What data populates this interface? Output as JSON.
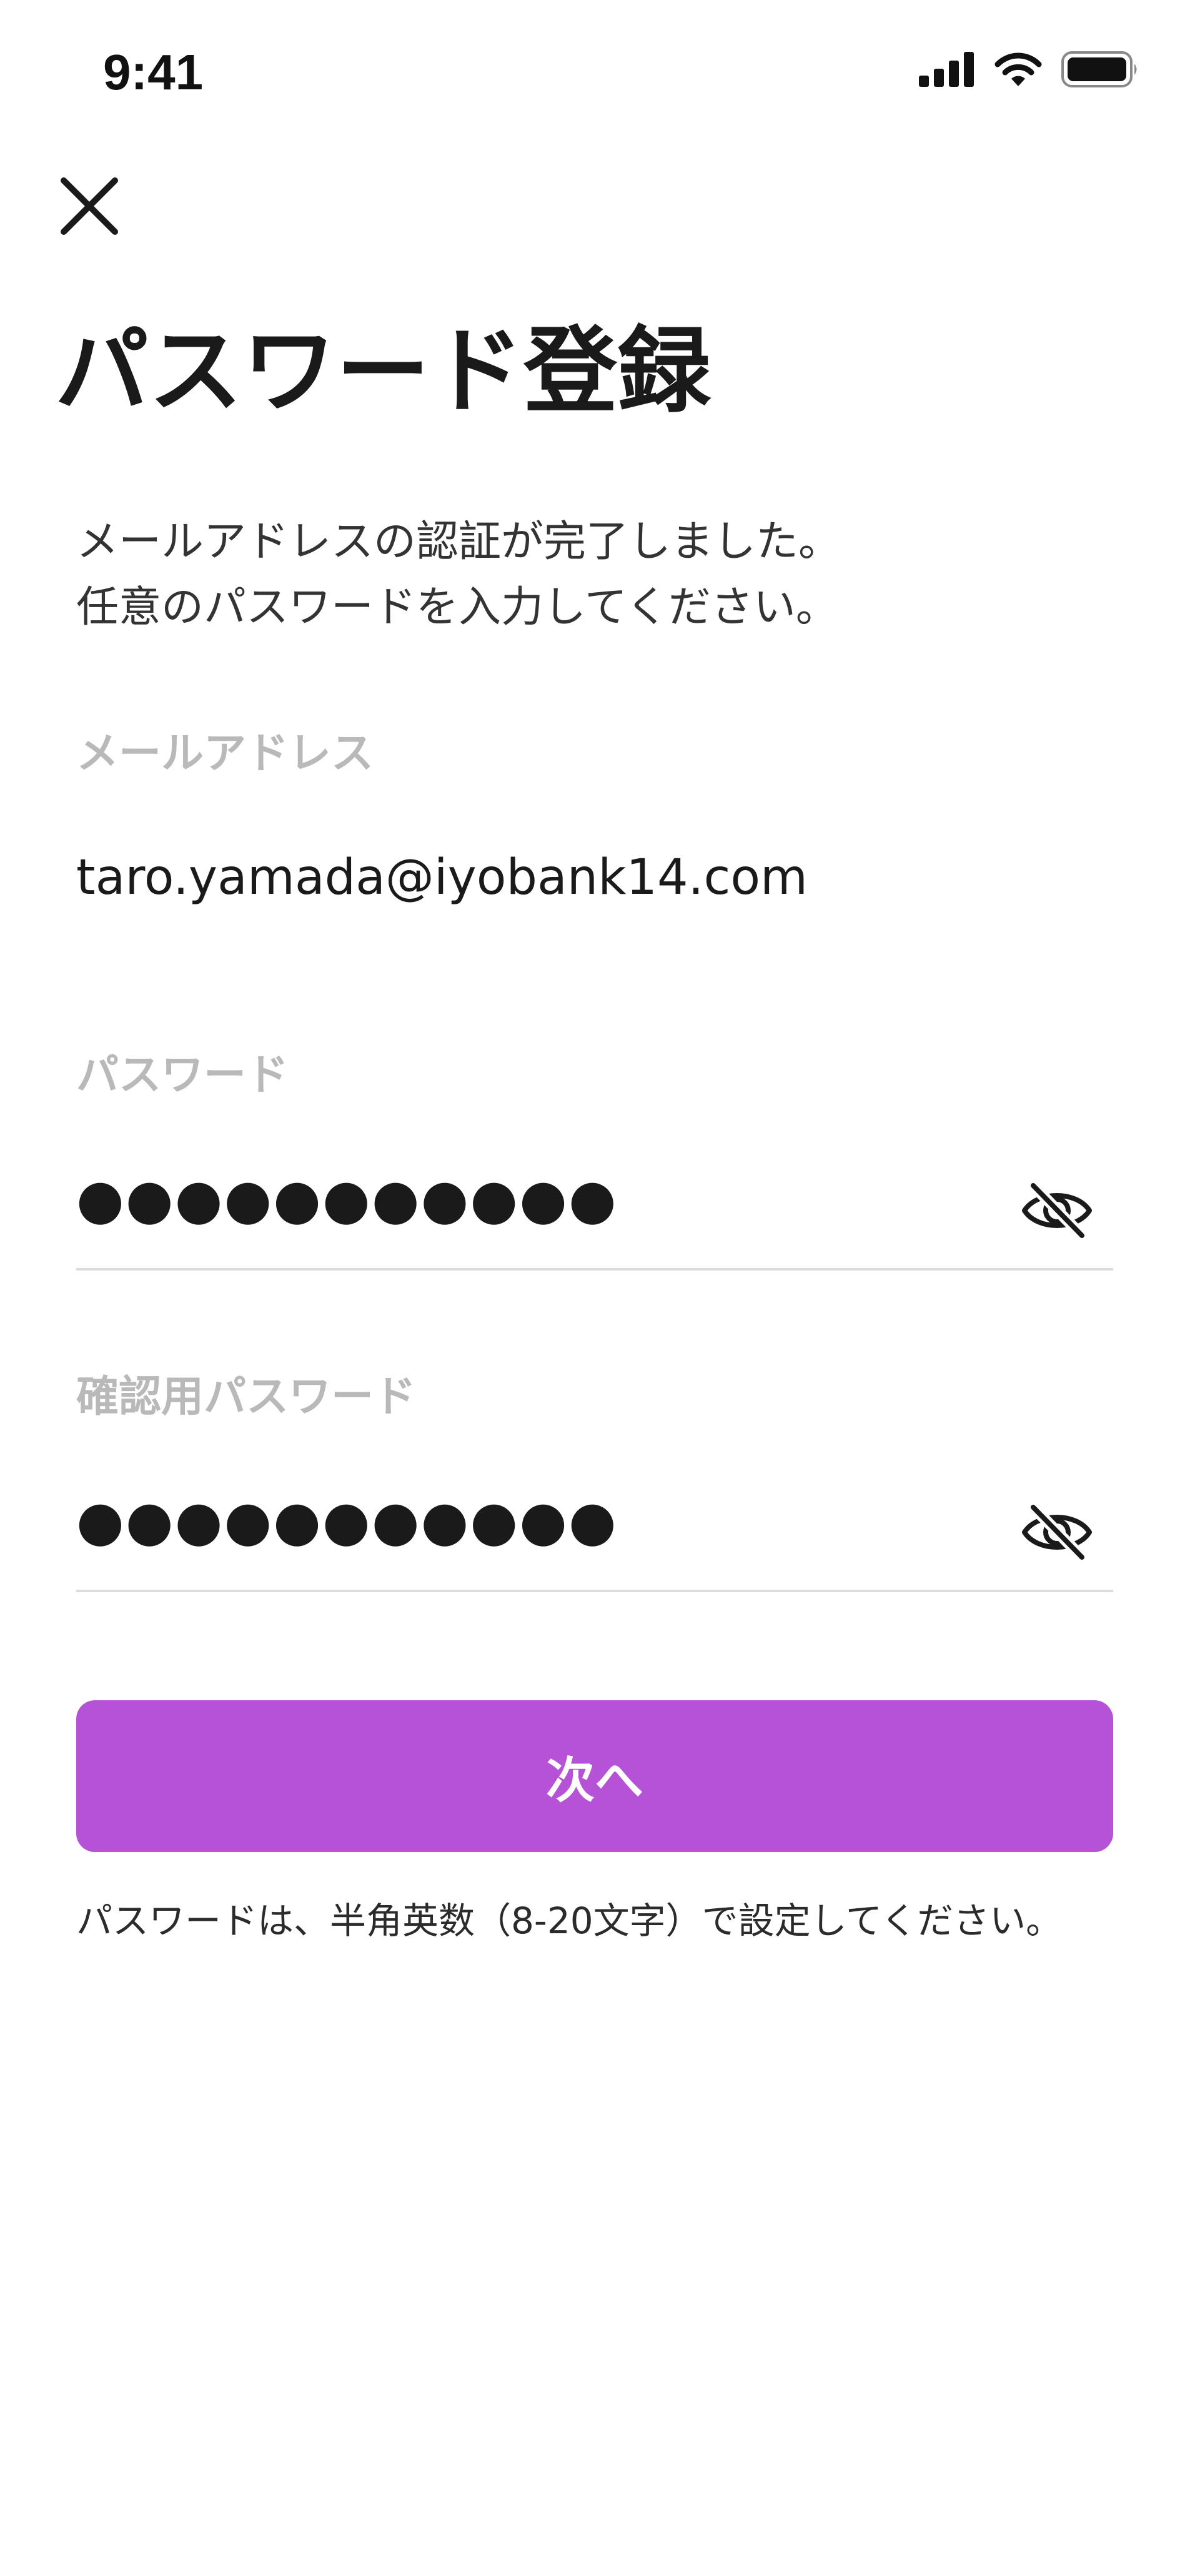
{
  "status_bar": {
    "time": "9:41",
    "icons": [
      "cellular-signal-icon",
      "wifi-icon",
      "battery-icon"
    ]
  },
  "header": {
    "close_icon": "close-icon",
    "title": "パスワード登録"
  },
  "description": {
    "line1": "メールアドレスの認証が完了しました。",
    "line2": "任意のパスワードを入力してください。"
  },
  "form": {
    "email_label": "メールアドレス",
    "email_value": "taro.yamada@iyobank14.com",
    "password_label": "パスワード",
    "password_value": "●●●●●●●●●●●",
    "confirm_label": "確認用パスワード",
    "confirm_value": "●●●●●●●●●●●",
    "toggle_icon": "eye-off-icon"
  },
  "next_button": {
    "label": "次へ"
  },
  "helper_text": "パスワードは、半角英数（8-20文字）で設定してください。",
  "colors": {
    "accent": "#b552d6",
    "label": "#b9b9b9",
    "text": "#1a1a1a",
    "divider": "#dcdcdc"
  }
}
